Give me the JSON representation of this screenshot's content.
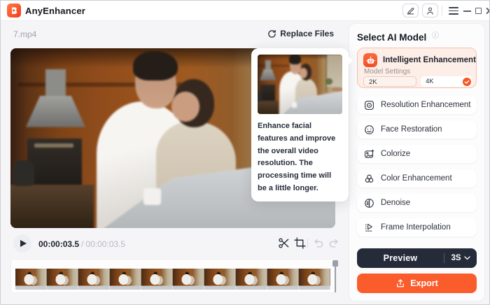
{
  "window": {
    "title": "AnyEnhancer"
  },
  "editor": {
    "filename": "7.mp4",
    "replace_files_label": "Replace Files",
    "tooltip": {
      "description": "Enhance facial features and improve the overall video resolution. The processing time will be a little longer."
    },
    "playback": {
      "current_time": "00:00:03.5",
      "separator": "/",
      "total_duration": "00:00:03.5"
    }
  },
  "sidebar": {
    "title": "Select AI Model",
    "selected_model": {
      "name": "Intelligent Enhancement",
      "settings_label": "Model Settings",
      "resolution_options": [
        {
          "label": "2K",
          "selected": false
        },
        {
          "label": "4K",
          "selected": true
        }
      ]
    },
    "models": [
      {
        "label": "Resolution Enhancement"
      },
      {
        "label": "Face Restoration"
      },
      {
        "label": "Colorize"
      },
      {
        "label": "Color Enhancement"
      },
      {
        "label": "Denoise"
      },
      {
        "label": "Frame Interpolation"
      }
    ],
    "preview": {
      "label": "Preview",
      "duration": "3S"
    },
    "export": {
      "label": "Export"
    }
  },
  "colors": {
    "accent": "#FB5C2C",
    "dark_button": "#262B3A",
    "selected_card_bg": "#FDEEE7",
    "selected_card_border": "#F6C3B2"
  }
}
